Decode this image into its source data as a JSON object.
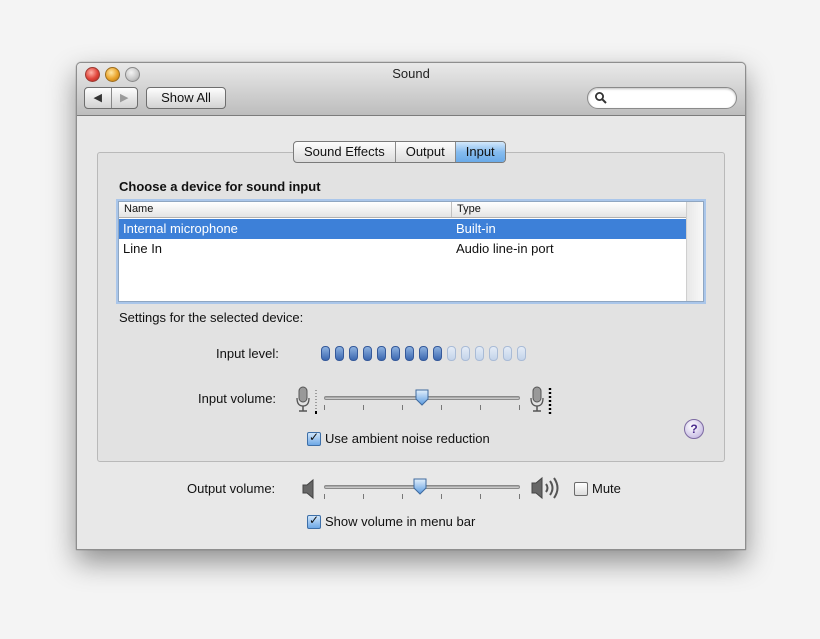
{
  "window": {
    "title": "Sound"
  },
  "toolbar": {
    "back_glyph": "◀",
    "forward_glyph": "▶",
    "show_all_label": "Show All",
    "search_placeholder": ""
  },
  "tabs": [
    {
      "label": "Sound Effects",
      "selected": false
    },
    {
      "label": "Output",
      "selected": false
    },
    {
      "label": "Input",
      "selected": true
    }
  ],
  "input": {
    "heading": "Choose a device for sound input",
    "columns": {
      "name": "Name",
      "type": "Type"
    },
    "devices": [
      {
        "name": "Internal microphone",
        "type": "Built-in",
        "selected": true
      },
      {
        "name": "Line In",
        "type": "Audio line-in port",
        "selected": false
      }
    ],
    "settings_label": "Settings for the selected device:",
    "input_level_label": "Input level:",
    "input_level": {
      "lit_segments": 9,
      "total_segments": 15
    },
    "input_volume_label": "Input volume:",
    "input_volume_fraction": 0.5,
    "ambient_noise_label": "Use ambient noise reduction",
    "ambient_noise_checked": true,
    "help_glyph": "?"
  },
  "output": {
    "volume_label": "Output volume:",
    "volume_fraction": 0.49,
    "mute_label": "Mute",
    "mute_checked": false,
    "menu_bar_label": "Show volume in menu bar",
    "menu_bar_checked": true
  },
  "colors": {
    "selection": "#3d80d8",
    "tab_active": "#86bcef",
    "meter_on": "#3b67b0",
    "meter_off": "#c3d3ea"
  }
}
